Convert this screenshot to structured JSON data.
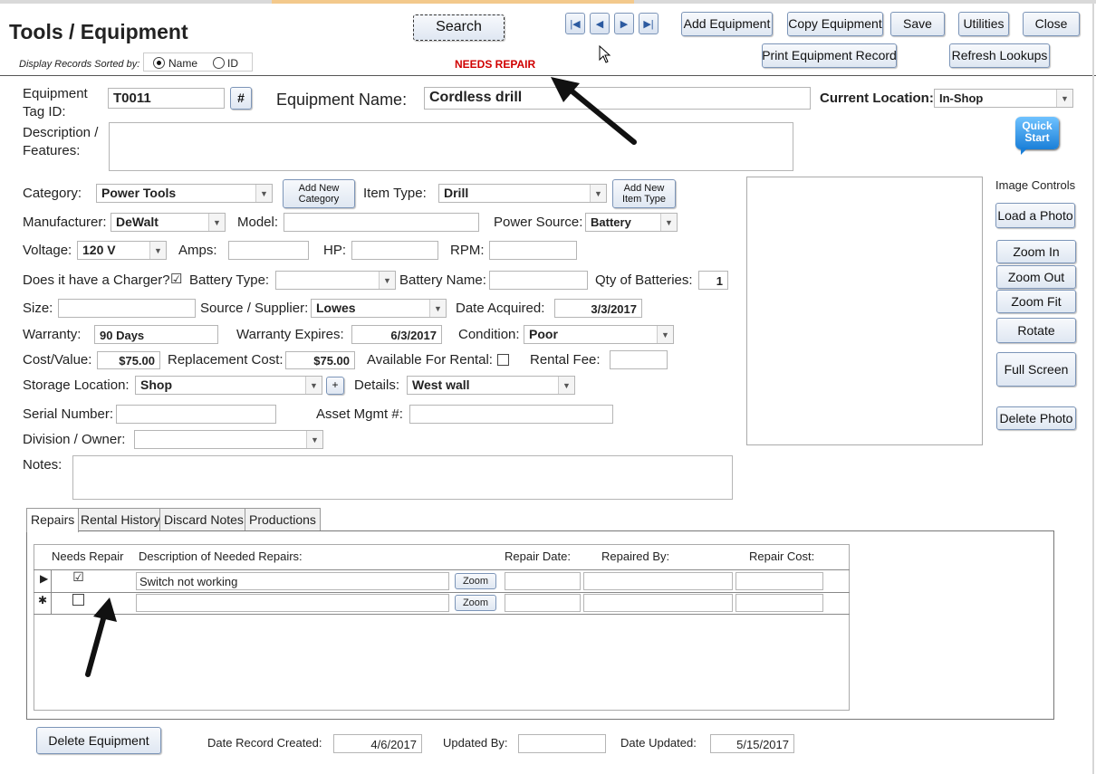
{
  "header": {
    "title": "Tools / Equipment",
    "sort_label": "Display Records Sorted by:",
    "sort_name": "Name",
    "sort_id": "ID",
    "status": "NEEDS REPAIR",
    "search": "Search",
    "add_equipment": "Add Equipment",
    "copy_equipment": "Copy Equipment",
    "save": "Save",
    "utilities": "Utilities",
    "close": "Close",
    "print_record": "Print Equipment Record",
    "refresh_lookups": "Refresh Lookups"
  },
  "form": {
    "tag_label": "Equipment Tag ID:",
    "tag_value": "T0011",
    "hash": "#",
    "name_label": "Equipment Name:",
    "name_value": "Cordless drill",
    "location_label": "Current Location:",
    "location_value": "In-Shop",
    "desc_label": "Description / Features:",
    "category_label": "Category:",
    "category_value": "Power Tools",
    "add_category": "Add New Category",
    "item_type_label": "Item Type:",
    "item_type_value": "Drill",
    "add_item_type": "Add New Item Type",
    "manufacturer_label": "Manufacturer:",
    "manufacturer_value": "DeWalt",
    "model_label": "Model:",
    "power_label": "Power Source:",
    "power_value": "Battery",
    "voltage_label": "Voltage:",
    "voltage_value": "120 V",
    "amps_label": "Amps:",
    "hp_label": "HP:",
    "rpm_label": "RPM:",
    "charger_label": "Does it have a Charger?",
    "charger_check": "☑",
    "battery_type_label": "Battery Type:",
    "battery_name_label": "Battery Name:",
    "qty_label": "Qty of Batteries:",
    "qty_value": "1",
    "size_label": "Size:",
    "source_label": "Source / Supplier:",
    "source_value": "Lowes",
    "date_acq_label": "Date Acquired:",
    "date_acq_value": "3/3/2017",
    "warranty_label": "Warranty:",
    "warranty_value": "90 Days",
    "warranty_exp_label": "Warranty Expires:",
    "warranty_exp_value": "6/3/2017",
    "condition_label": "Condition:",
    "condition_value": "Poor",
    "cost_label": "Cost/Value:",
    "cost_value": "$75.00",
    "replacement_label": "Replacement Cost:",
    "replacement_value": "$75.00",
    "rental_avail_label": "Available For Rental:",
    "rental_fee_label": "Rental Fee:",
    "storage_label": "Storage Location:",
    "storage_value": "Shop",
    "plus": "+",
    "details_label": "Details:",
    "details_value": "West wall",
    "serial_label": "Serial Number:",
    "asset_label": "Asset Mgmt #:",
    "division_label": "Division / Owner:",
    "notes_label": "Notes:"
  },
  "image": {
    "quick_start": "Quick Start",
    "controls_label": "Image Controls",
    "load": "Load a Photo",
    "zoom_in": "Zoom In",
    "zoom_out": "Zoom Out",
    "zoom_fit": "Zoom Fit",
    "rotate": "Rotate",
    "full_screen": "Full Screen",
    "delete": "Delete Photo"
  },
  "tabs": [
    "Repairs",
    "Rental History",
    "Discard Notes",
    "Productions"
  ],
  "repairs": {
    "headers": [
      "Needs Repair",
      "Description of Needed Repairs:",
      "Repair Date:",
      "Repaired By:",
      "Repair Cost:"
    ],
    "rows": [
      {
        "selector": "▶",
        "check": "☑",
        "description": "Switch not working",
        "zoom": "Zoom"
      },
      {
        "selector": "✱",
        "check": "",
        "description": "",
        "zoom": "Zoom"
      }
    ]
  },
  "footer": {
    "delete_equipment": "Delete Equipment",
    "created_label": "Date Record Created:",
    "created_value": "4/6/2017",
    "updated_by_label": "Updated By:",
    "updated_label": "Date Updated:",
    "updated_value": "5/15/2017"
  },
  "icons": {
    "first": "first-record-icon",
    "prev": "prev-record-icon",
    "next": "next-record-icon",
    "last": "last-record-icon",
    "arrow": "annotation-arrow"
  }
}
